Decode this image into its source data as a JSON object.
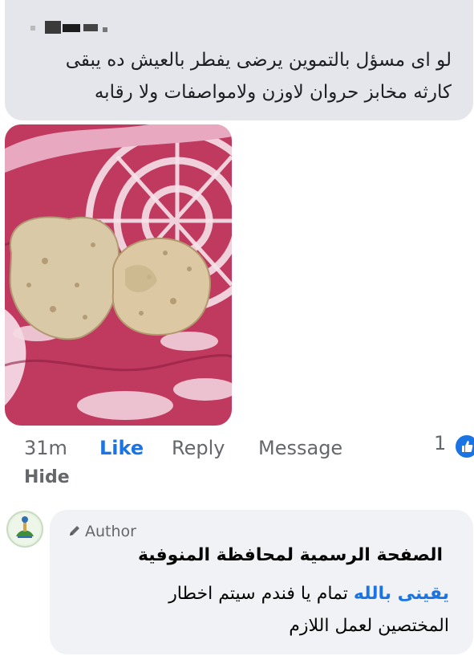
{
  "comment": {
    "author_name": "- --- .",
    "text_line1": "لو اى مسؤل بالتموين  يرضى يفطر بالعيش ده يبقى",
    "text_line2": "كارثه مخابز حروان  لاوزن ولامواصفات ولا رقابه"
  },
  "actions": {
    "time": "31m",
    "like": "Like",
    "reply": "Reply",
    "message": "Message",
    "hide": "Hide",
    "reaction_count": "1"
  },
  "reply": {
    "author_badge": "Author",
    "page_name": "الصفحة الرسمية لمحافظة المنوفية",
    "mention": "يقينى بالله",
    "text_rest": " تمام يا فندم سيتم اخطار",
    "text_line2": "المختصين لعمل اللازم"
  },
  "colors": {
    "accent": "#1b74e4",
    "bubble": "#e4e6eb",
    "secondary_text": "#65676b"
  }
}
